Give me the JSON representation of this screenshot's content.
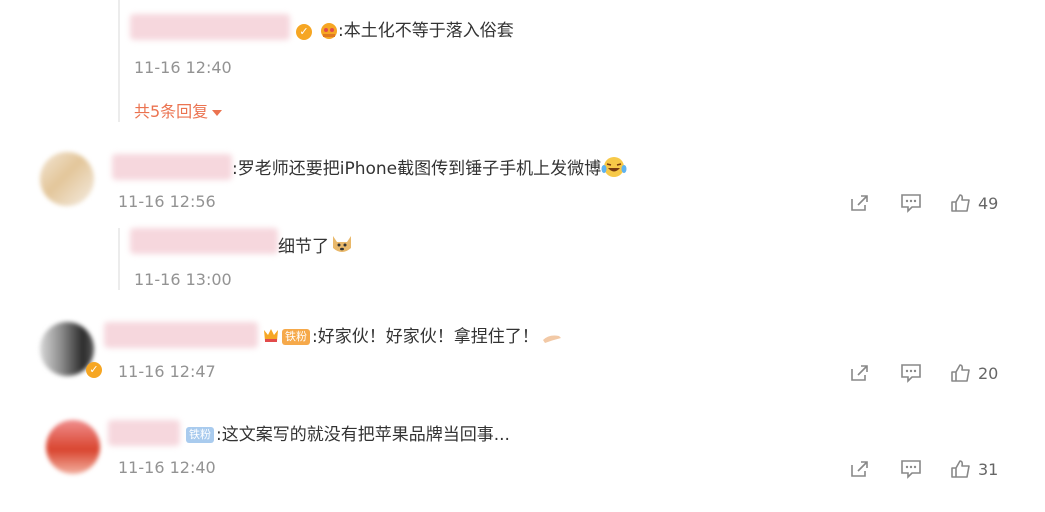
{
  "replies_top": {
    "reply1": {
      "text": ":本土化不等于落入俗套",
      "time": "11-16 12:40"
    },
    "more_label": "共5条回复"
  },
  "comments": [
    {
      "text": ":罗老师还要把iPhone截图传到锤子手机上发微博",
      "time": "11-16 12:56",
      "likes": "49",
      "reply": {
        "text": "细节了",
        "time": "11-16 13:00"
      }
    },
    {
      "badge": "铁粉",
      "text": ":好家伙！好家伙！拿捏住了！",
      "time": "11-16 12:47",
      "likes": "20"
    },
    {
      "badge": "铁粉",
      "text": ":这文案写的就没有把苹果品牌当回事...",
      "time": "11-16 12:40",
      "likes": "31"
    }
  ],
  "icons": {
    "share": "share-icon",
    "comment": "comment-icon",
    "like": "thumbs-up-icon"
  },
  "colors": {
    "accent": "#eb7350",
    "time": "#939393",
    "badge": "#a9cbee",
    "verified": "#f6a623"
  }
}
